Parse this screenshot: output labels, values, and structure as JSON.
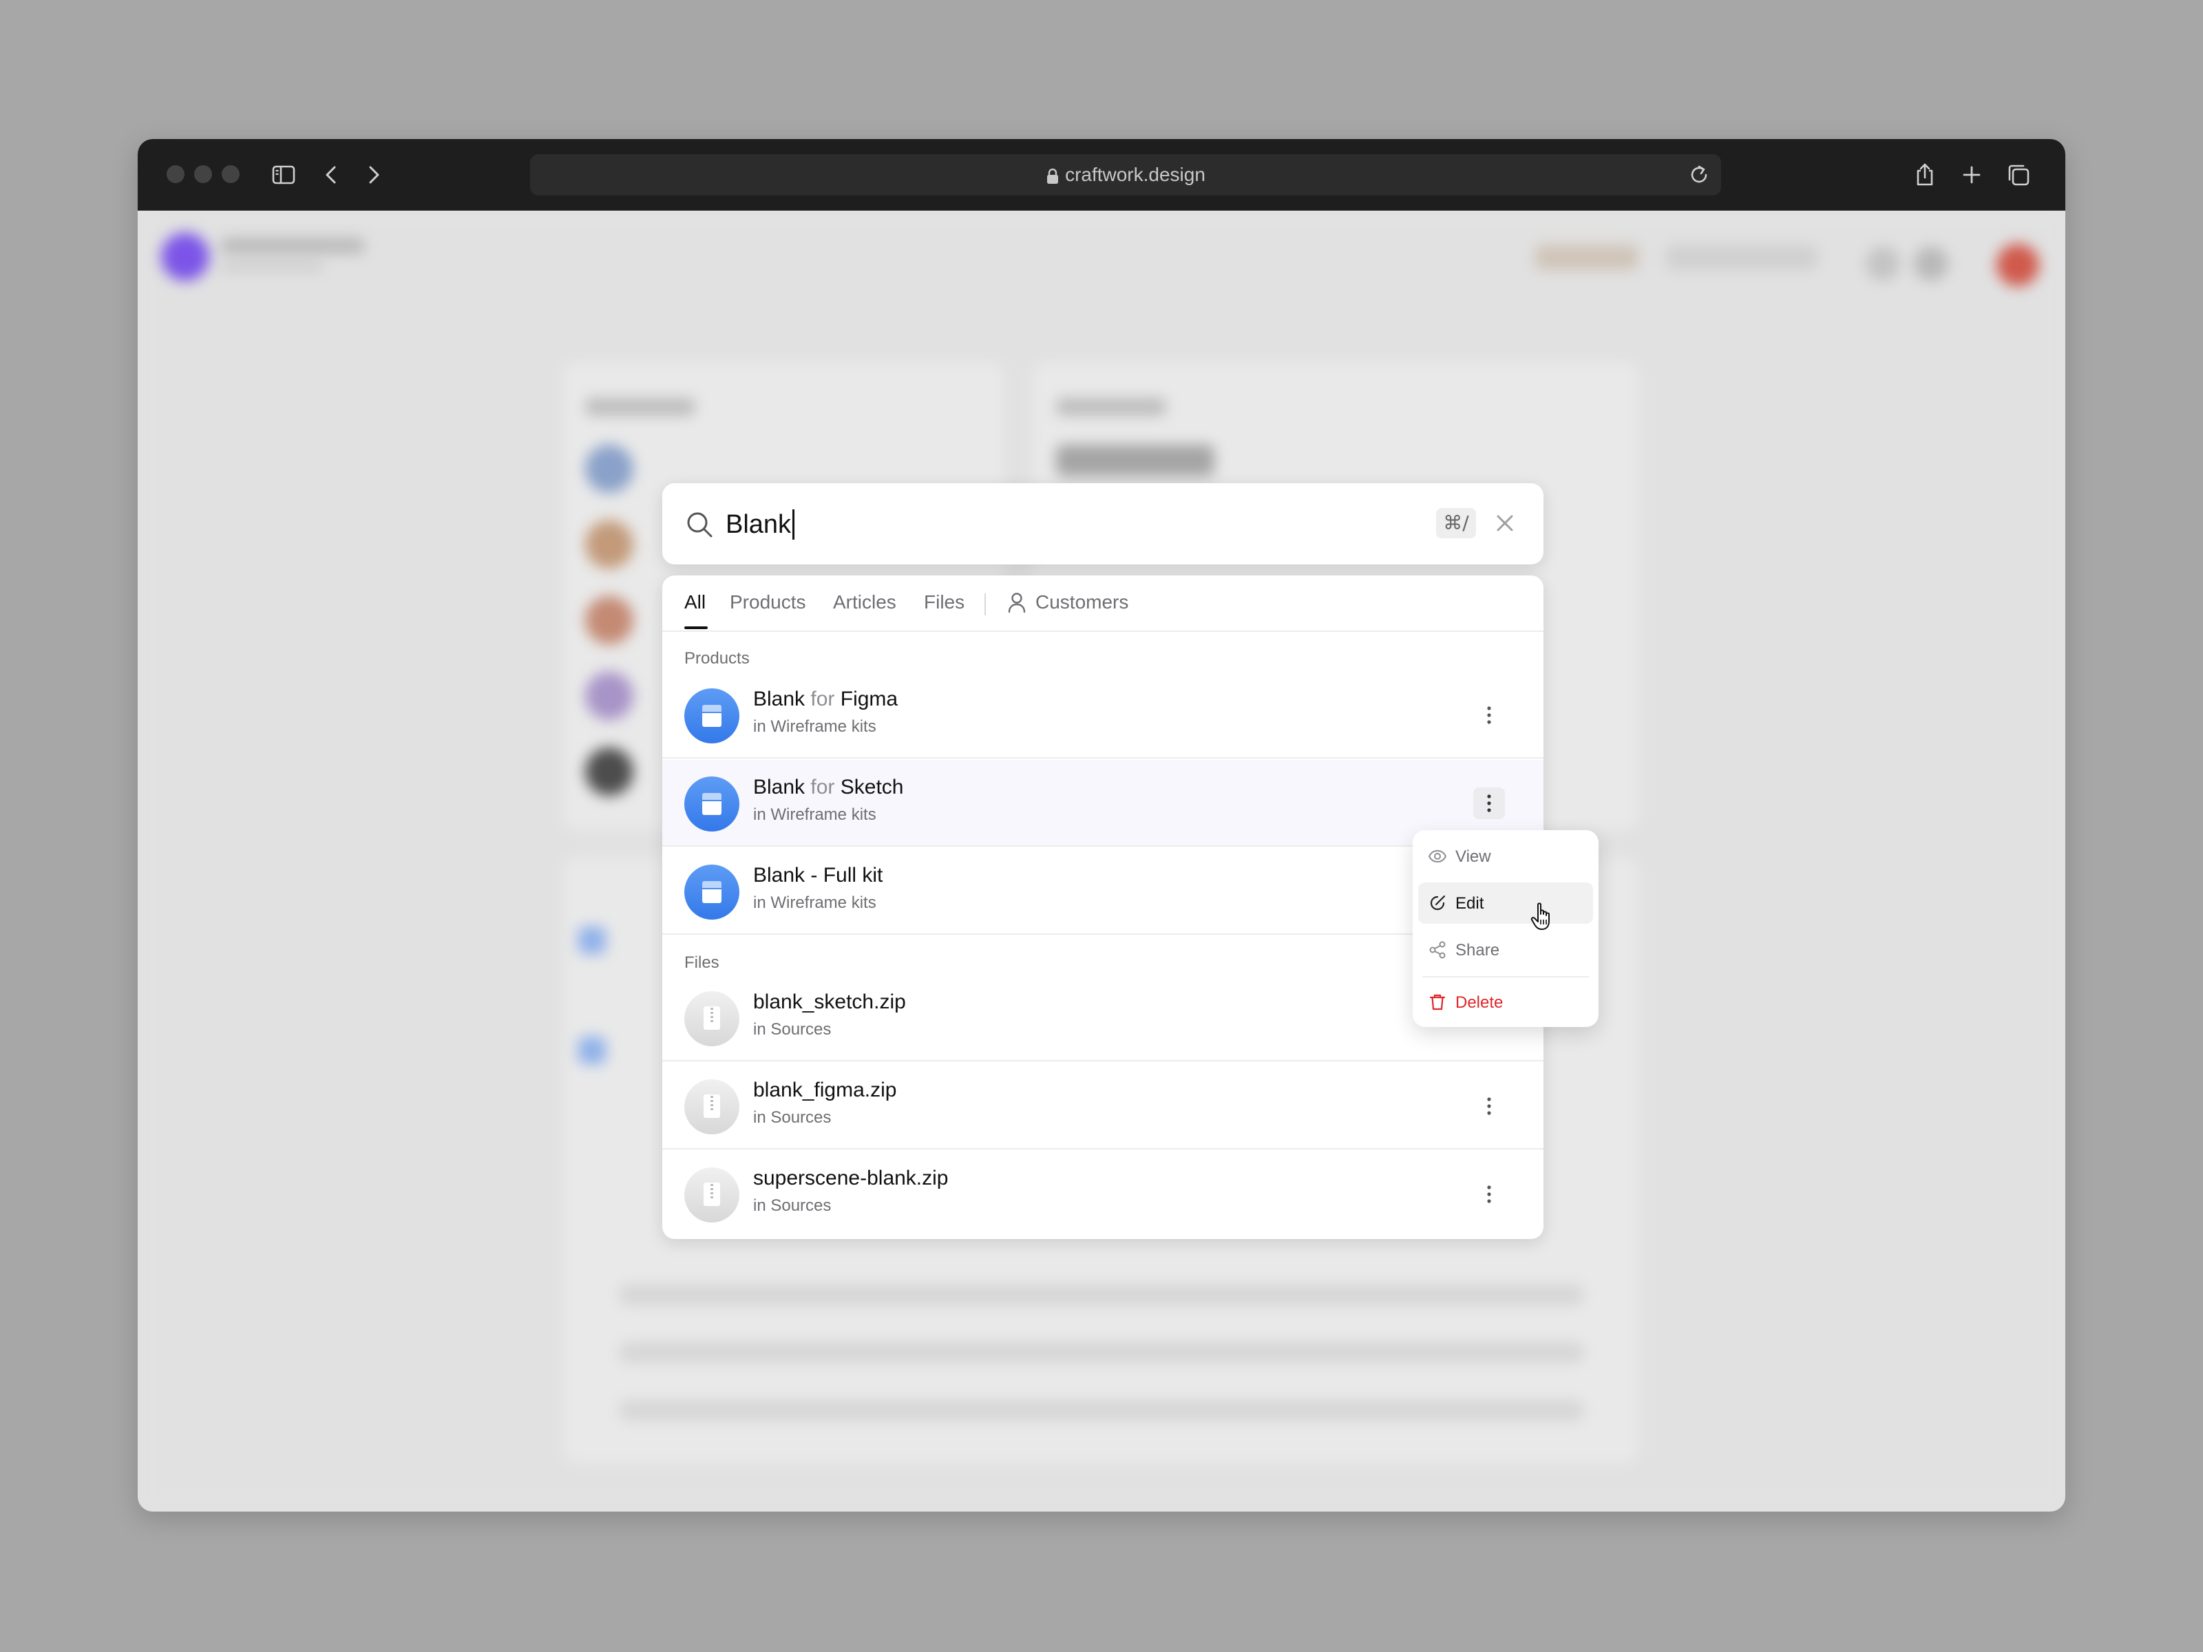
{
  "browser": {
    "url": "craftwork.design"
  },
  "search": {
    "query": "Blank",
    "shortcut": "⌘/"
  },
  "tabs": [
    {
      "label": "All"
    },
    {
      "label": "Products"
    },
    {
      "label": "Articles"
    },
    {
      "label": "Files"
    },
    {
      "label": "Customers"
    }
  ],
  "sections": {
    "products": "Products",
    "files": "Files"
  },
  "products": [
    {
      "name": "Blank",
      "connector": "for",
      "platform": "Figma",
      "location": "in Wireframe kits"
    },
    {
      "name": "Blank",
      "connector": "for",
      "platform": "Sketch",
      "location": "in Wireframe kits"
    },
    {
      "name": "Blank - Full kit",
      "location": "in Wireframe kits"
    }
  ],
  "files": [
    {
      "name": "blank_sketch.zip",
      "location": "in Sources"
    },
    {
      "name": "blank_figma.zip",
      "location": "in Sources"
    },
    {
      "name": "superscene-blank.zip",
      "location": "in Sources"
    }
  ],
  "context_menu": {
    "view": "View",
    "edit": "Edit",
    "share": "Share",
    "delete": "Delete"
  },
  "colors": {
    "accent_blue": "#3479ea",
    "danger": "#e0252b"
  }
}
